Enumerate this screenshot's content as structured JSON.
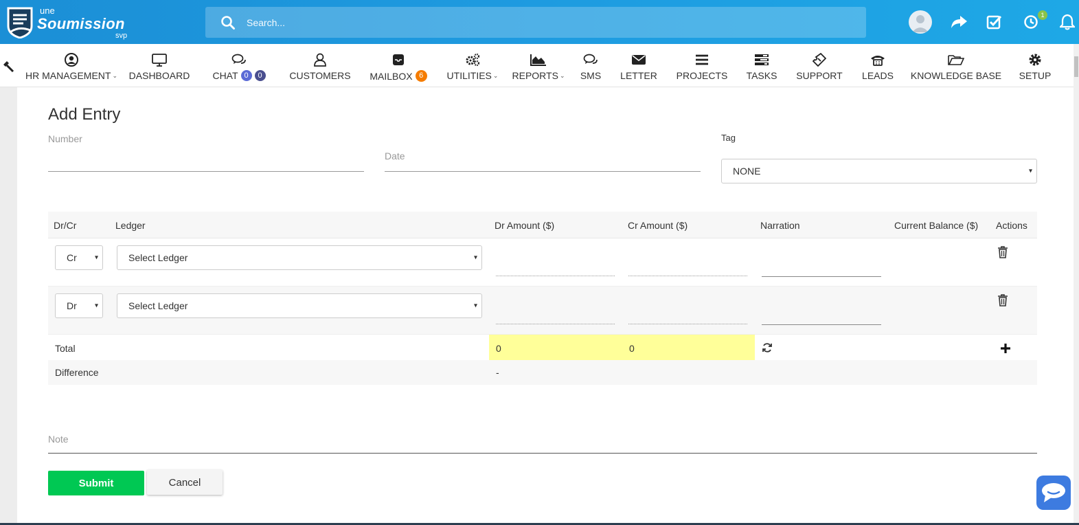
{
  "brand": {
    "prefix": "une",
    "name": "Soumission",
    "suffix": "svp"
  },
  "search": {
    "placeholder": "Search..."
  },
  "header": {
    "notification_count": "1"
  },
  "nav": {
    "items": [
      {
        "label": "HR MANAGEMENT",
        "icon": "user-circle-icon",
        "dropdown": true
      },
      {
        "label": "DASHBOARD",
        "icon": "monitor-icon"
      },
      {
        "label": "CHAT",
        "icon": "chat-icon",
        "badges": [
          "0",
          "0"
        ]
      },
      {
        "label": "CUSTOMERS",
        "icon": "user-icon"
      },
      {
        "label": "MAILBOX",
        "icon": "inbox-icon",
        "badge": "6"
      },
      {
        "label": "UTILITIES",
        "icon": "cogs-icon",
        "dropdown": true
      },
      {
        "label": "REPORTS",
        "icon": "area-chart-icon",
        "dropdown": true
      },
      {
        "label": "SMS",
        "icon": "comments-icon"
      },
      {
        "label": "LETTER",
        "icon": "envelope-icon"
      },
      {
        "label": "PROJECTS",
        "icon": "bars-icon"
      },
      {
        "label": "TASKS",
        "icon": "tasks-icon"
      },
      {
        "label": "SUPPORT",
        "icon": "ticket-icon"
      },
      {
        "label": "LEADS",
        "icon": "phone-icon"
      },
      {
        "label": "KNOWLEDGE BASE",
        "icon": "folder-open-icon"
      },
      {
        "label": "SETUP",
        "icon": "cog-icon"
      }
    ]
  },
  "form": {
    "title": "Add Entry",
    "number_label": "Number",
    "date_label": "Date",
    "tag_label": "Tag",
    "tag_value": "NONE",
    "note_label": "Note",
    "submit_label": "Submit",
    "cancel_label": "Cancel"
  },
  "table": {
    "columns": [
      "Dr/Cr",
      "Ledger",
      "Dr Amount ($)",
      "Cr Amount ($)",
      "Narration",
      "Current Balance ($)",
      "Actions"
    ],
    "rows": [
      {
        "type": "Cr",
        "ledger": "Select Ledger"
      },
      {
        "type": "Dr",
        "ledger": "Select Ledger"
      }
    ],
    "total_label": "Total",
    "total_dr": "0",
    "total_cr": "0",
    "difference_label": "Difference",
    "difference_value": "-"
  },
  "colors": {
    "header_blue": "#1e9be0",
    "submit_green": "#00c853",
    "total_highlight": "#ffff99",
    "chat_badge": "#5b6bd6",
    "mailbox_badge": "#f57c00"
  }
}
